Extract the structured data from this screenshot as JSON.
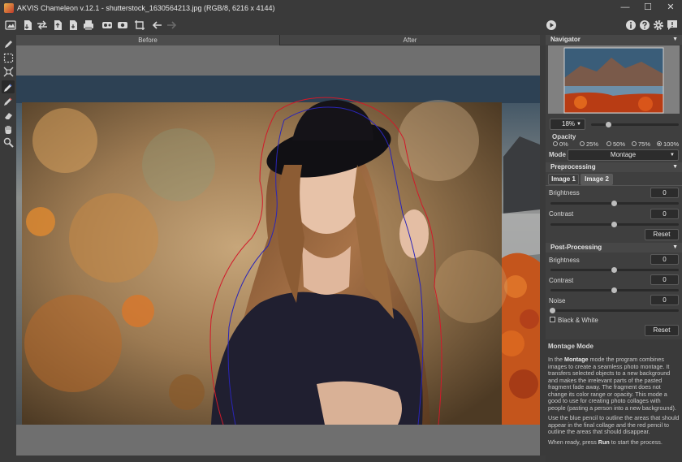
{
  "window": {
    "title": "AKVIS Chameleon v.12.1 - shutterstock_1630564213.jpg (RGB/8, 6216 x 4144)",
    "minimize": "—",
    "maximize": "☐",
    "close": "✕"
  },
  "toolbar": {
    "icons": [
      "open-image-icon",
      "open-background-icon",
      "swap-icon",
      "save-icon",
      "export-icon",
      "print-icon",
      "batch-icon",
      "share-icon",
      "crop-icon",
      "undo-icon",
      "redo-icon"
    ],
    "right_icons": [
      "run-icon",
      "info-icon",
      "help-icon",
      "settings-icon",
      "notifications-icon"
    ]
  },
  "tools": [
    "pencil-icon",
    "selection-icon",
    "transform-icon",
    "keep-pencil-icon",
    "erase-pencil-icon",
    "eraser-icon",
    "hand-icon",
    "zoom-icon"
  ],
  "canvas": {
    "tab_before": "Before",
    "tab_after": "After"
  },
  "navigator": {
    "title": "Navigator",
    "zoom": "18%",
    "zoom_level": 0.18
  },
  "opacity": {
    "label": "Opacity",
    "options": [
      "0%",
      "25%",
      "50%",
      "75%",
      "100%"
    ],
    "selected": "100%"
  },
  "mode": {
    "label": "Mode",
    "value": "Montage"
  },
  "preprocessing": {
    "title": "Preprocessing",
    "tab1": "Image 1",
    "tab2": "Image 2",
    "brightness_label": "Brightness",
    "brightness": "0",
    "contrast_label": "Contrast",
    "contrast": "0",
    "reset": "Reset"
  },
  "postprocessing": {
    "title": "Post-Processing",
    "brightness_label": "Brightness",
    "brightness": "0",
    "contrast_label": "Contrast",
    "contrast": "0",
    "noise_label": "Noise",
    "noise": "0",
    "bw_label": "Black & White",
    "reset": "Reset"
  },
  "help": {
    "title": "Montage Mode",
    "p1_a": "In the ",
    "p1_b": "Montage",
    "p1_c": " mode the program combines images to create a seamless photo montage. It transfers selected objects to a new background and makes the irrelevant parts of the pasted fragment fade away. The fragment does not change its color range or opacity. This mode a good to use for creating photo collages with people (pasting a person into a new background).",
    "p2": "Use the blue pencil to outline the areas that should appear in the final collage and the red pencil to outline the areas that should disappear.",
    "p3_a": "When ready, press ",
    "p3_b": "Run",
    "p3_c": " to start the process."
  }
}
